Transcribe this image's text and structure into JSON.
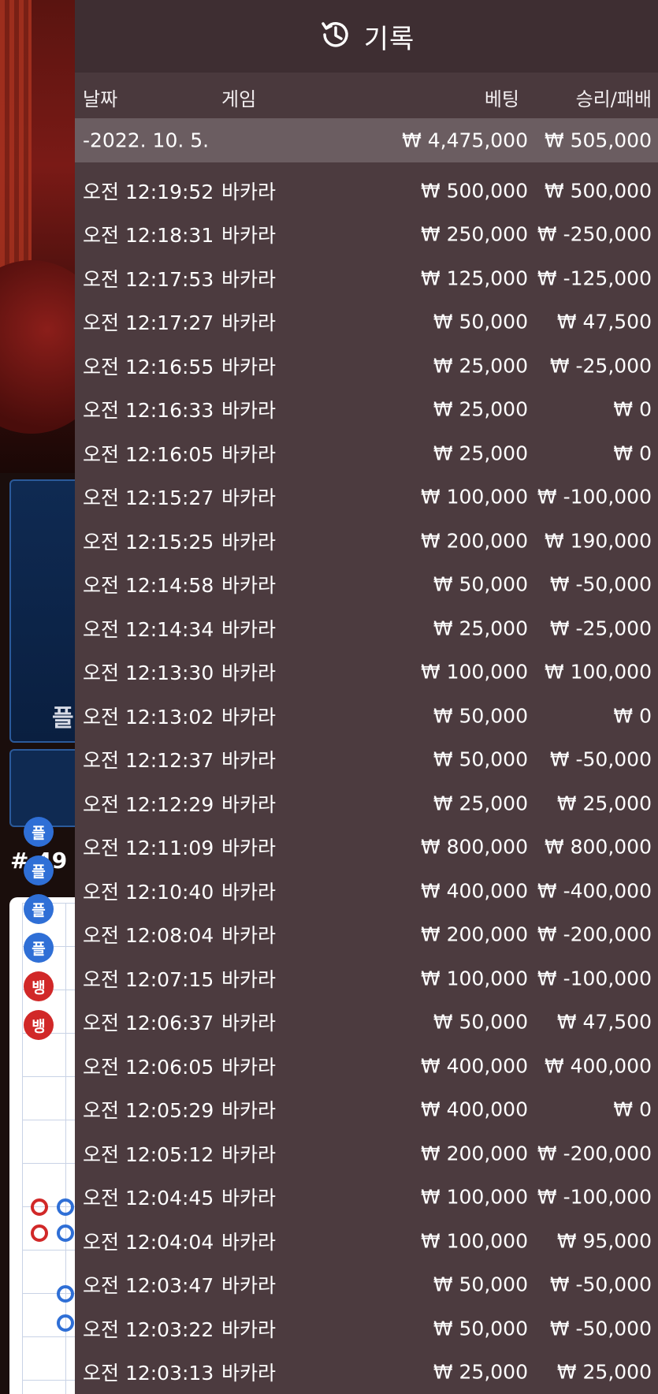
{
  "header": {
    "title": "기록",
    "icon": "history-icon"
  },
  "columns": {
    "date": "날짜",
    "game": "게임",
    "bet": "베팅",
    "result": "승리/패배"
  },
  "summary": {
    "date": "-2022. 10. 5.",
    "bet": "₩ 4,475,000",
    "result": "₩ 505,000"
  },
  "rows": [
    {
      "time": "오전 12:19:52",
      "game": "바카라",
      "bet": "₩ 500,000",
      "result": "₩ 500,000"
    },
    {
      "time": "오전 12:18:31",
      "game": "바카라",
      "bet": "₩ 250,000",
      "result": "₩ -250,000"
    },
    {
      "time": "오전 12:17:53",
      "game": "바카라",
      "bet": "₩ 125,000",
      "result": "₩ -125,000"
    },
    {
      "time": "오전 12:17:27",
      "game": "바카라",
      "bet": "₩ 50,000",
      "result": "₩ 47,500"
    },
    {
      "time": "오전 12:16:55",
      "game": "바카라",
      "bet": "₩ 25,000",
      "result": "₩ -25,000"
    },
    {
      "time": "오전 12:16:33",
      "game": "바카라",
      "bet": "₩ 25,000",
      "result": "₩ 0"
    },
    {
      "time": "오전 12:16:05",
      "game": "바카라",
      "bet": "₩ 25,000",
      "result": "₩ 0"
    },
    {
      "time": "오전 12:15:27",
      "game": "바카라",
      "bet": "₩ 100,000",
      "result": "₩ -100,000"
    },
    {
      "time": "오전 12:15:25",
      "game": "바카라",
      "bet": "₩ 200,000",
      "result": "₩ 190,000"
    },
    {
      "time": "오전 12:14:58",
      "game": "바카라",
      "bet": "₩ 50,000",
      "result": "₩ -50,000"
    },
    {
      "time": "오전 12:14:34",
      "game": "바카라",
      "bet": "₩ 25,000",
      "result": "₩ -25,000"
    },
    {
      "time": "오전 12:13:30",
      "game": "바카라",
      "bet": "₩ 100,000",
      "result": "₩ 100,000"
    },
    {
      "time": "오전 12:13:02",
      "game": "바카라",
      "bet": "₩ 50,000",
      "result": "₩ 0"
    },
    {
      "time": "오전 12:12:37",
      "game": "바카라",
      "bet": "₩ 50,000",
      "result": "₩ -50,000"
    },
    {
      "time": "오전 12:12:29",
      "game": "바카라",
      "bet": "₩ 25,000",
      "result": "₩ 25,000"
    },
    {
      "time": "오전 12:11:09",
      "game": "바카라",
      "bet": "₩ 800,000",
      "result": "₩ 800,000"
    },
    {
      "time": "오전 12:10:40",
      "game": "바카라",
      "bet": "₩ 400,000",
      "result": "₩ -400,000"
    },
    {
      "time": "오전 12:08:04",
      "game": "바카라",
      "bet": "₩ 200,000",
      "result": "₩ -200,000"
    },
    {
      "time": "오전 12:07:15",
      "game": "바카라",
      "bet": "₩ 100,000",
      "result": "₩ -100,000"
    },
    {
      "time": "오전 12:06:37",
      "game": "바카라",
      "bet": "₩ 50,000",
      "result": "₩ 47,500"
    },
    {
      "time": "오전 12:06:05",
      "game": "바카라",
      "bet": "₩ 400,000",
      "result": "₩ 400,000"
    },
    {
      "time": "오전 12:05:29",
      "game": "바카라",
      "bet": "₩ 400,000",
      "result": "₩ 0"
    },
    {
      "time": "오전 12:05:12",
      "game": "바카라",
      "bet": "₩ 200,000",
      "result": "₩ -200,000"
    },
    {
      "time": "오전 12:04:45",
      "game": "바카라",
      "bet": "₩ 100,000",
      "result": "₩ -100,000"
    },
    {
      "time": "오전 12:04:04",
      "game": "바카라",
      "bet": "₩ 100,000",
      "result": "₩ 95,000"
    },
    {
      "time": "오전 12:03:47",
      "game": "바카라",
      "bet": "₩ 50,000",
      "result": "₩ -50,000"
    },
    {
      "time": "오전 12:03:22",
      "game": "바카라",
      "bet": "₩ 50,000",
      "result": "₩ -50,000"
    },
    {
      "time": "오전 12:03:13",
      "game": "바카라",
      "bet": "₩ 25,000",
      "result": "₩ 25,000"
    }
  ],
  "background": {
    "player_label": "플",
    "round": "# 49",
    "road_chips": [
      {
        "label": "플",
        "color": "#2f6fd6"
      },
      {
        "label": "플",
        "color": "#2f6fd6"
      },
      {
        "label": "플",
        "color": "#2f6fd6"
      },
      {
        "label": "플",
        "color": "#2f6fd6"
      },
      {
        "label": "뱅",
        "color": "#d12828"
      },
      {
        "label": "뱅",
        "color": "#d12828"
      }
    ]
  }
}
